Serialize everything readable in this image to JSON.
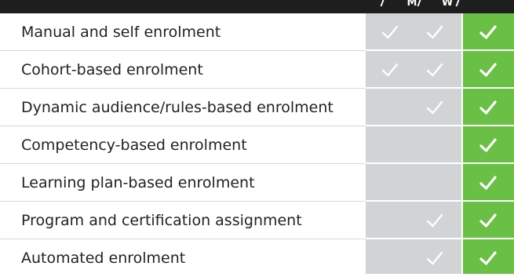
{
  "header": {
    "columns": [
      {
        "label": "M"
      },
      {
        "label": "W"
      }
    ]
  },
  "colors": {
    "header_bg": "#1e1e1e",
    "gray_col": "#d1d3d4",
    "green_col": "#6abf45",
    "check_on_gray": "#ffffff",
    "check_on_green": "#ffffff"
  },
  "rows": [
    {
      "label": "Manual and self enrolment",
      "checks": [
        true,
        true,
        true
      ]
    },
    {
      "label": "Cohort-based enrolment",
      "checks": [
        true,
        true,
        true
      ]
    },
    {
      "label": "Dynamic audience/rules-based enrolment",
      "checks": [
        false,
        true,
        true
      ]
    },
    {
      "label": "Competency-based enrolment",
      "checks": [
        false,
        false,
        true
      ]
    },
    {
      "label": "Learning plan-based enrolment",
      "checks": [
        false,
        false,
        true
      ]
    },
    {
      "label": "Program and certification assignment",
      "checks": [
        false,
        true,
        true
      ]
    },
    {
      "label": "Automated enrolment",
      "checks": [
        false,
        true,
        true
      ]
    }
  ]
}
